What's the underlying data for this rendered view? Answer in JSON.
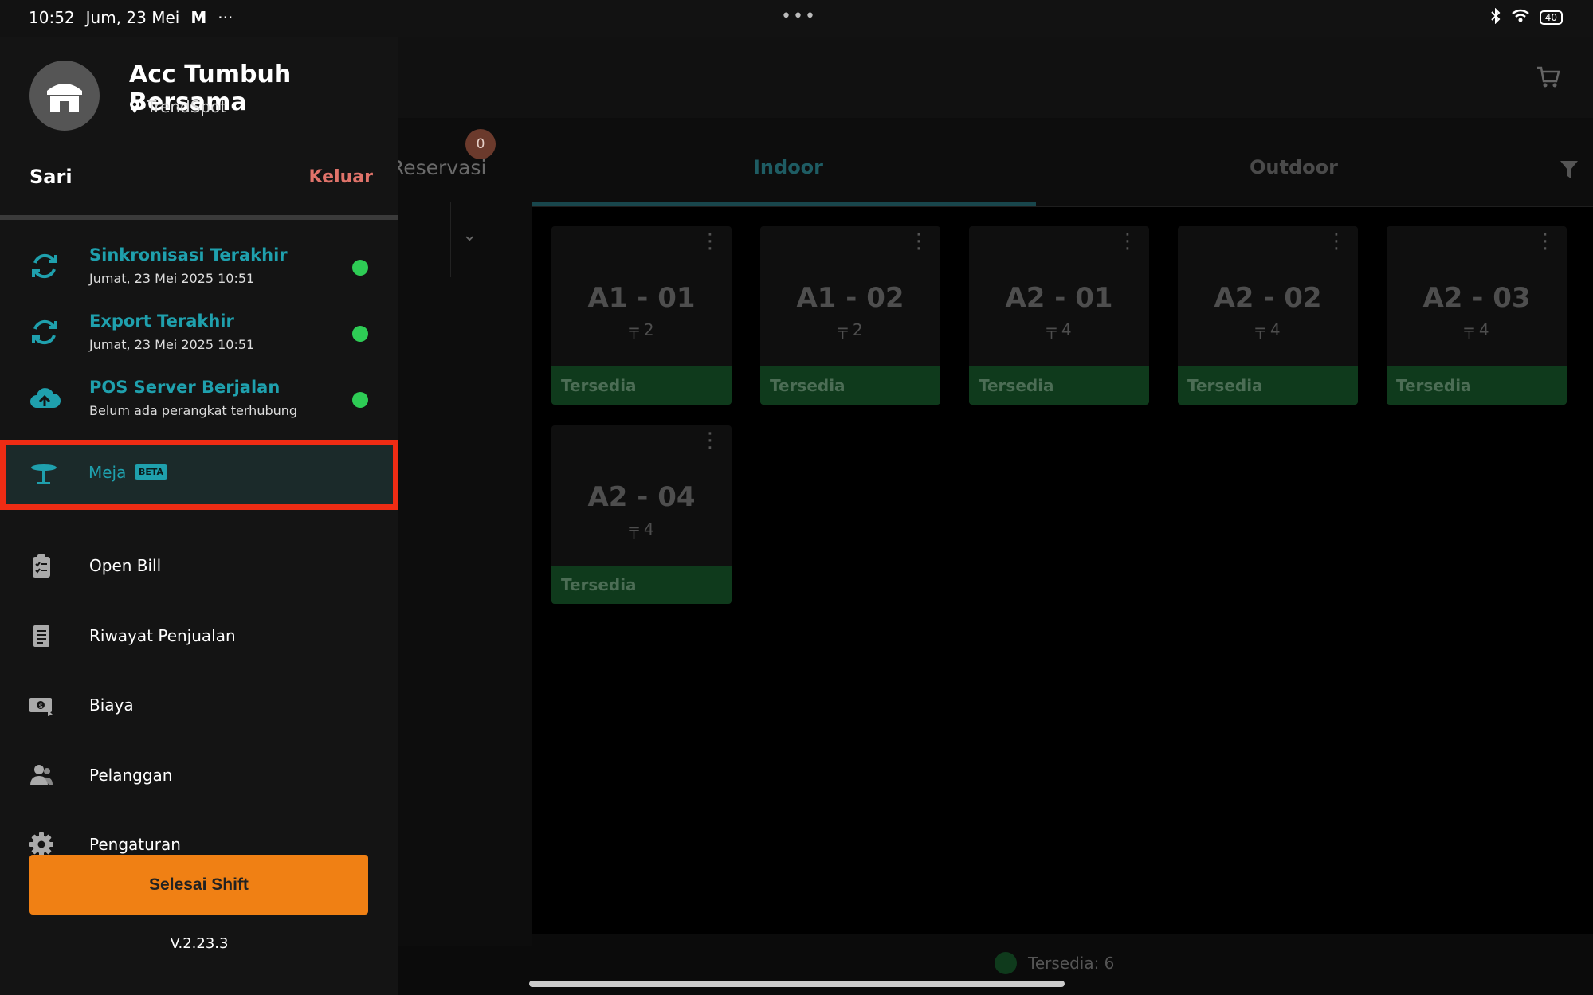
{
  "status_bar": {
    "time": "10:52",
    "date": "Jum, 23 Mei",
    "mail_glyph": "M",
    "more_dots": "···",
    "center_dots": "•••",
    "battery": "40"
  },
  "drawer": {
    "store_name": "Acc Tumbuh Bersama",
    "store_location": "TrendSpot",
    "user_name": "Sari",
    "logout_label": "Keluar",
    "status_items": [
      {
        "title": "Sinkronisasi Terakhir",
        "subtitle": "Jumat, 23 Mei 2025 10:51",
        "icon": "sync-icon",
        "dot_color": "#2ecc55"
      },
      {
        "title": "Export Terakhir",
        "subtitle": "Jumat, 23 Mei 2025 10:51",
        "icon": "export-sync-icon",
        "dot_color": "#2ecc55"
      },
      {
        "title": "POS Server Berjalan",
        "subtitle": "Belum ada perangkat terhubung",
        "icon": "cloud-server-icon",
        "dot_color": "#2ecc55"
      }
    ],
    "active_item": {
      "label": "Meja",
      "badge": "BETA",
      "icon": "table-icon"
    },
    "menu_items": [
      {
        "label": "Open Bill",
        "icon": "clipboard-icon"
      },
      {
        "label": "Riwayat Penjualan",
        "icon": "document-icon"
      },
      {
        "label": "Biaya",
        "icon": "money-icon"
      },
      {
        "label": "Pelanggan",
        "icon": "people-icon"
      },
      {
        "label": "Pengaturan",
        "icon": "gear-icon"
      }
    ],
    "end_shift_label": "Selesai Shift",
    "version": "V.2.23.3"
  },
  "background": {
    "reservasi_label": "Reservasi",
    "reservasi_count": "0",
    "tabs": [
      {
        "label": "Indoor",
        "active": true
      },
      {
        "label": "Outdoor",
        "active": false
      }
    ],
    "tables": [
      {
        "name": "A1 - 01",
        "seats": "2",
        "status": "Tersedia"
      },
      {
        "name": "A1 - 02",
        "seats": "2",
        "status": "Tersedia"
      },
      {
        "name": "A2 - 01",
        "seats": "4",
        "status": "Tersedia"
      },
      {
        "name": "A2 - 02",
        "seats": "4",
        "status": "Tersedia"
      },
      {
        "name": "A2 - 03",
        "seats": "4",
        "status": "Tersedia"
      },
      {
        "name": "A2 - 04",
        "seats": "4",
        "status": "Tersedia"
      }
    ],
    "footer_summary": "Tersedia: 6"
  },
  "colors": {
    "accent": "#1fa0ad",
    "highlight_border": "#ee2c14",
    "end_shift": "#f08014",
    "logout": "#e0736a",
    "available": "#0f3a1c"
  }
}
